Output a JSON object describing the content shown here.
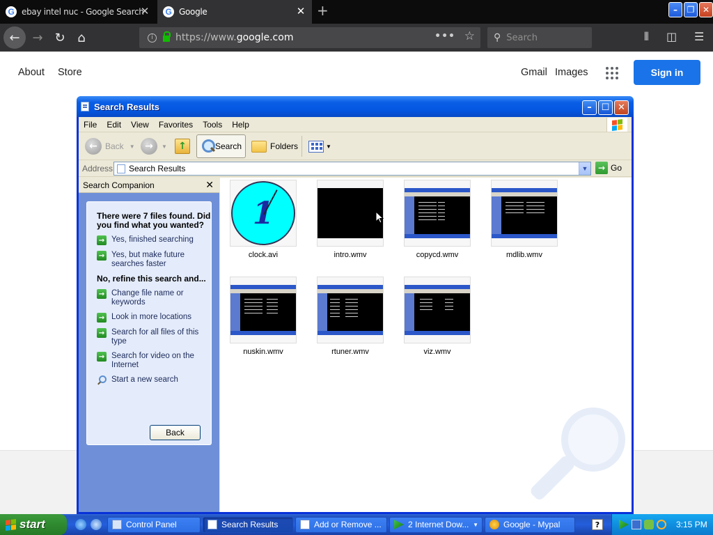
{
  "browser": {
    "tabs": [
      {
        "title": "ebay intel nuc - Google Search",
        "favicon": "google-g-icon",
        "active": false
      },
      {
        "title": "Google",
        "favicon": "google-g-icon",
        "active": true
      }
    ],
    "url_scheme": "https://www.",
    "url_domain": "google.com",
    "search_placeholder": "Search"
  },
  "google": {
    "left_links": [
      "About",
      "Store"
    ],
    "right_links": [
      "Gmail",
      "Images"
    ],
    "signin_label": "Sign in",
    "accent": "#1a73e8"
  },
  "explorer": {
    "title": "Search Results",
    "menu": [
      "File",
      "Edit",
      "View",
      "Favorites",
      "Tools",
      "Help"
    ],
    "toolbar": {
      "back": "Back",
      "search": "Search",
      "folders": "Folders"
    },
    "address_label": "Address",
    "address_value": "Search Results",
    "go_label": "Go",
    "companion": {
      "header": "Search Companion",
      "question": "There were 7 files found. Did you find what you wanted?",
      "options_yes": [
        "Yes, finished searching",
        "Yes, but make future searches faster"
      ],
      "refine_heading": "No, refine this search and...",
      "options_refine": [
        "Change file name or keywords",
        "Look in more locations",
        "Search for all files of this type",
        "Search for video on the Internet"
      ],
      "new_search": "Start a new search",
      "back_button": "Back"
    },
    "files": [
      {
        "name": "clock.avi",
        "thumb": "clock"
      },
      {
        "name": "intro.wmv",
        "thumb": "black"
      },
      {
        "name": "copycd.wmv",
        "thumb": "screenshot"
      },
      {
        "name": "mdlib.wmv",
        "thumb": "screenshot"
      },
      {
        "name": "nuskin.wmv",
        "thumb": "screenshot"
      },
      {
        "name": "rtuner.wmv",
        "thumb": "screenshot"
      },
      {
        "name": "viz.wmv",
        "thumb": "screenshot"
      }
    ]
  },
  "taskbar": {
    "start_label": "start",
    "tasks": [
      {
        "label": "Control Panel",
        "active": false
      },
      {
        "label": "Search Results",
        "active": true
      },
      {
        "label": "Add or Remove ...",
        "active": false
      },
      {
        "label": "2 Internet Dow...",
        "active": false
      },
      {
        "label": "Google - Mypal",
        "active": false
      }
    ],
    "clock": "3:15 PM"
  }
}
